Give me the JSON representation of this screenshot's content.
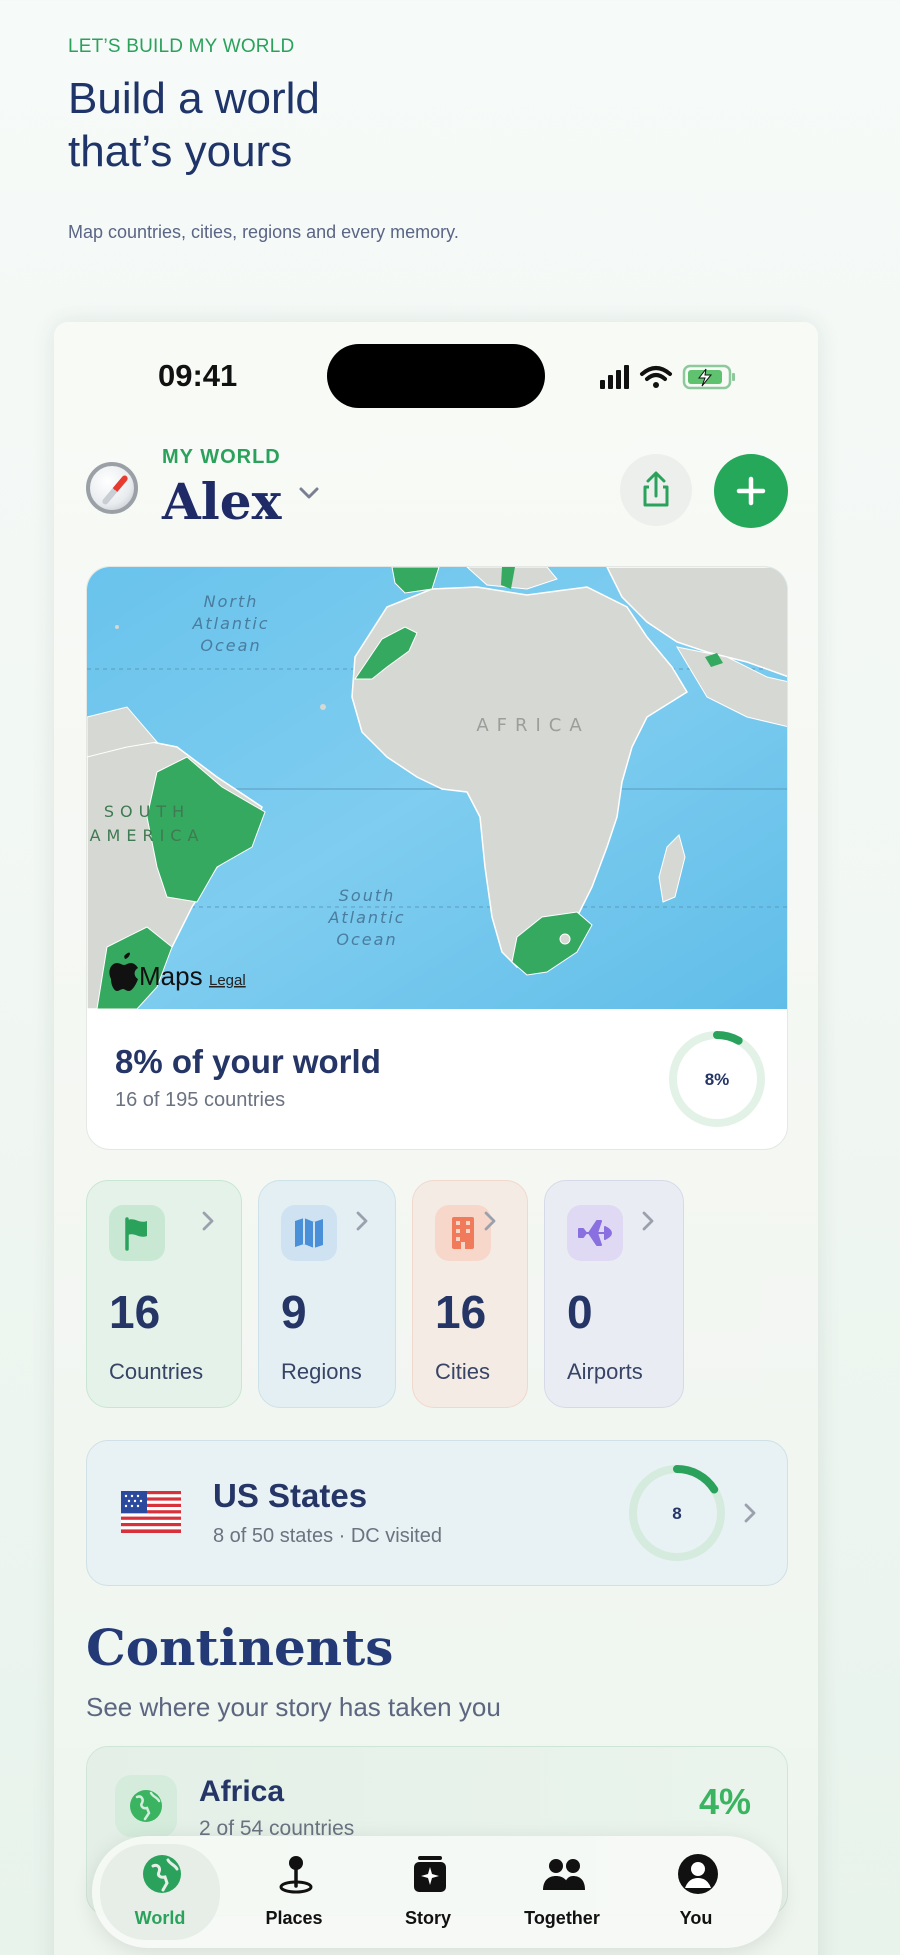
{
  "hero": {
    "eyebrow": "LET’S BUILD MY WORLD",
    "title_line1": "Build a world",
    "title_line2": "that’s yours",
    "subtitle": "Map countries, cities, regions and every memory."
  },
  "status_bar": {
    "time": "09:41"
  },
  "header": {
    "label": "MY WORLD",
    "name": "Alex"
  },
  "map": {
    "labels": {
      "north_atlantic": [
        "North",
        "Atlantic",
        "Ocean"
      ],
      "africa": "AFRICA",
      "south_america": [
        "SOUTH",
        "AMERICA"
      ],
      "south_atlantic": [
        "South",
        "Atlantic",
        "Ocean"
      ]
    },
    "brand": "Maps",
    "legal": "Legal",
    "visited_color": "#35a95f"
  },
  "world_progress": {
    "headline": "8% of your world",
    "sub": "16 of 195 countries",
    "ring_label": "8%",
    "fraction": 0.082
  },
  "stats": [
    {
      "value": "16",
      "label": "Countries",
      "icon": "flag-icon",
      "color": "#2aa25c"
    },
    {
      "value": "9",
      "label": "Regions",
      "icon": "map-icon",
      "color": "#4a90d9"
    },
    {
      "value": "16",
      "label": "Cities",
      "icon": "building-icon",
      "color": "#f07a5a"
    },
    {
      "value": "0",
      "label": "Airports",
      "icon": "plane-icon",
      "color": "#8a6fe0"
    }
  ],
  "us_states": {
    "title": "US States",
    "sub": "8 of 50 states · DC visited",
    "ring_label": "8",
    "fraction": 0.16
  },
  "continents": {
    "title": "Continents",
    "sub": "See where your story has taken you",
    "items": [
      {
        "name": "Africa",
        "sub": "2 of 54 countries",
        "pct": "4%"
      }
    ]
  },
  "tabs": [
    {
      "label": "World",
      "icon": "globe-icon",
      "active": true
    },
    {
      "label": "Places",
      "icon": "pin-icon",
      "active": false
    },
    {
      "label": "Story",
      "icon": "story-icon",
      "active": false
    },
    {
      "label": "Together",
      "icon": "people-icon",
      "active": false
    },
    {
      "label": "You",
      "icon": "person-icon",
      "active": false
    }
  ]
}
